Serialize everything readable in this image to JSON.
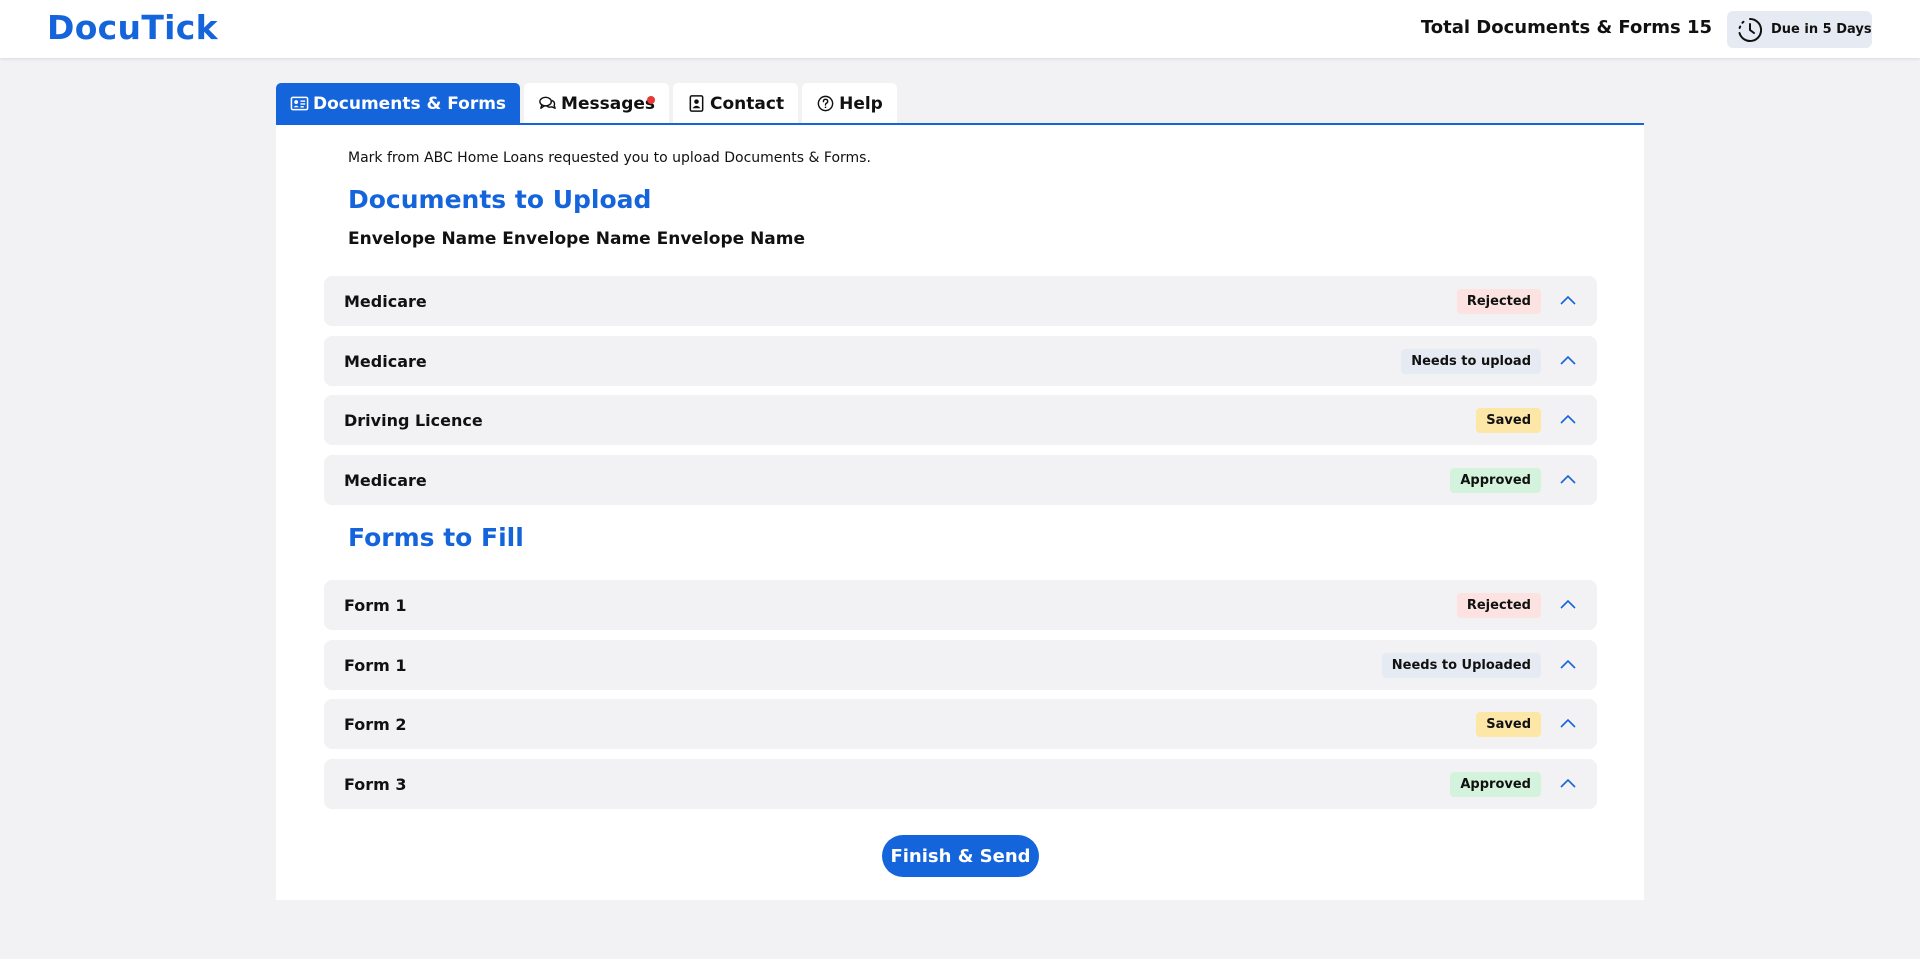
{
  "header": {
    "logo": "DocuTick",
    "total_label": "Total Documents & Forms 15",
    "due_label": "Due in 5 Days"
  },
  "tabs": [
    {
      "label": "Documents & Forms",
      "icon": "id-card-icon",
      "active": true
    },
    {
      "label": "Messages",
      "icon": "chat-icon",
      "notification": true
    },
    {
      "label": "Contact",
      "icon": "contact-card-icon"
    },
    {
      "label": "Help",
      "icon": "question-circle-icon"
    }
  ],
  "main": {
    "intro": "Mark from ABC Home Loans requested you to upload Documents & Forms.",
    "documents_heading": "Documents to Upload",
    "envelope_name": "Envelope Name Envelope Name Envelope Name",
    "forms_heading": "Forms to Fill",
    "finish_label": "Finish & Send"
  },
  "documents": [
    {
      "name": "Medicare",
      "status": "Rejected"
    },
    {
      "name": "Medicare",
      "status": "Needs to upload"
    },
    {
      "name": "Driving Licence",
      "status": "Saved"
    },
    {
      "name": "Medicare",
      "status": "Approved"
    }
  ],
  "forms": [
    {
      "name": "Form 1",
      "status": "Rejected"
    },
    {
      "name": "Form 1",
      "status": "Needs to Uploaded"
    },
    {
      "name": "Form 2",
      "status": "Saved"
    },
    {
      "name": "Form 3",
      "status": "Approved"
    }
  ],
  "colors": {
    "accent": "#1464dc",
    "rejected_bg": "#fde2e2",
    "needs_bg": "#e6ebf3",
    "saved_bg": "#fde7a6",
    "approved_bg": "#d4f3dc",
    "notification_dot": "#e53935"
  }
}
